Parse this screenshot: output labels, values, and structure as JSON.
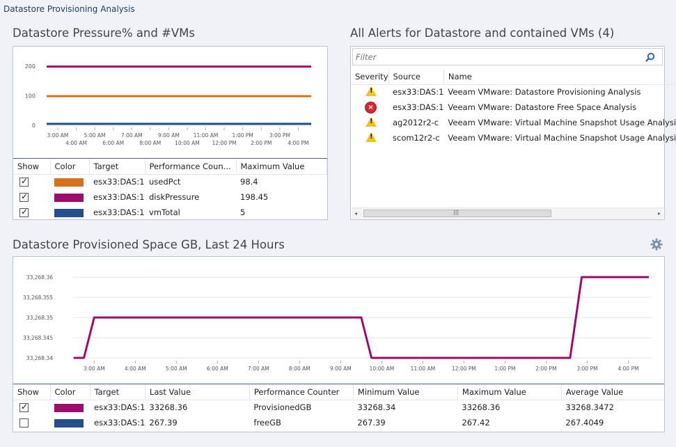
{
  "page": {
    "title": "Datastore Provisioning Analysis"
  },
  "pressure": {
    "title": "Datastore Pressure% and #VMs",
    "chart_data": {
      "type": "line",
      "x_ticks_upper": [
        "3:00 AM",
        "5:00 AM",
        "7:00 AM",
        "9:00 AM",
        "11:00 AM",
        "1:00 PM",
        "3:00 PM"
      ],
      "x_ticks_lower": [
        "4:00 AM",
        "6:00 AM",
        "8:00 AM",
        "10:00 AM",
        "12:00 PM",
        "2:00 PM",
        "4:00 PM"
      ],
      "y_ticks": [
        "200",
        "100",
        "0"
      ],
      "ylim": [
        0,
        200
      ],
      "series": [
        {
          "name": "usedPct",
          "color": "#d4731c",
          "values": [
            98.4,
            98.4
          ]
        },
        {
          "name": "diskPressure",
          "color": "#9e0c6a",
          "values": [
            198.45,
            198.45
          ]
        },
        {
          "name": "vmTotal",
          "color": "#254f8c",
          "values": [
            5,
            5
          ]
        }
      ]
    },
    "grid": {
      "headers": [
        "Show",
        "Color",
        "Target",
        "Performance Coun...",
        "Maximum Value"
      ],
      "rows": [
        {
          "show": true,
          "color": "#d4731c",
          "target": "esx33:DAS:1",
          "counter": "usedPct",
          "max": "98.4"
        },
        {
          "show": true,
          "color": "#9e0c6a",
          "target": "esx33:DAS:1",
          "counter": "diskPressure",
          "max": "198.45"
        },
        {
          "show": true,
          "color": "#254f8c",
          "target": "esx33:DAS:1",
          "counter": "vmTotal",
          "max": "5"
        }
      ]
    }
  },
  "alerts": {
    "title": "All Alerts for Datastore and contained VMs (4)",
    "filter_placeholder": "Filter",
    "search_icon": "search-icon",
    "headers": [
      "Severity",
      "Source",
      "Name"
    ],
    "rows": [
      {
        "severity": "warning",
        "source": "esx33:DAS:1",
        "name": "Veeam VMware: Datastore Provisioning Analysis"
      },
      {
        "severity": "critical",
        "source": "esx33:DAS:1",
        "name": "Veeam VMware: Datastore Free Space Analysis"
      },
      {
        "severity": "warning",
        "source": "ag2012r2-c",
        "name": "Veeam VMware: Virtual Machine Snapshot Usage Analysis"
      },
      {
        "severity": "warning",
        "source": "scom12r2-c",
        "name": "Veeam VMware: Virtual Machine Snapshot Usage Analysis"
      }
    ],
    "scroll_left": "◂",
    "scroll_right": "▸",
    "scroll_grip": "|||"
  },
  "provisioned": {
    "title": "Datastore Provisioned Space GB, Last 24 Hours",
    "settings_icon": "gear-icon",
    "chart_data": {
      "type": "line",
      "x_ticks": [
        "3:00 AM",
        "4:00 AM",
        "5:00 AM",
        "6:00 AM",
        "7:00 AM",
        "8:00 AM",
        "9:00 AM",
        "10:00 AM",
        "11:00 AM",
        "12:00 PM",
        "1:00 PM",
        "2:00 PM",
        "3:00 PM",
        "4:00 PM"
      ],
      "y_ticks": [
        "33,268.36",
        "33,268.355",
        "33,268.35",
        "33,268.345",
        "33,268.34"
      ],
      "ylim": [
        33268.34,
        33268.36
      ],
      "series": [
        {
          "name": "ProvisionedGB",
          "color": "#9e0c6a",
          "x": [
            "2:30 AM",
            "2:45 AM",
            "3:00 AM",
            "9:30 AM",
            "9:45 AM",
            "2:35 PM",
            "2:52 PM",
            "4:30 PM"
          ],
          "values": [
            33268.34,
            33268.34,
            33268.35,
            33268.35,
            33268.34,
            33268.34,
            33268.36,
            33268.36
          ]
        }
      ]
    },
    "grid": {
      "headers": [
        "Show",
        "Color",
        "Target",
        "Last Value",
        "Performance Counter",
        "Minimum Value",
        "Maximum Value",
        "Average Value"
      ],
      "rows": [
        {
          "show": true,
          "color": "#9e0c6a",
          "target": "esx33:DAS:1",
          "last": "33268.36",
          "counter": "ProvisionedGB",
          "min": "33268.34",
          "max": "33268.36",
          "avg": "33268.3472"
        },
        {
          "show": false,
          "color": "#254f8c",
          "target": "esx33:DAS:1",
          "last": "267.39",
          "counter": "freeGB",
          "min": "267.39",
          "max": "267.42",
          "avg": "267.4049"
        }
      ]
    }
  }
}
